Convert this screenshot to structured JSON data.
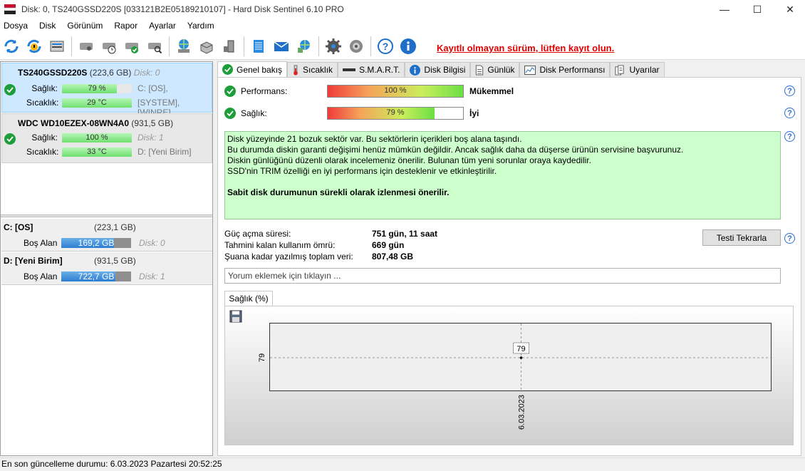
{
  "window": {
    "title": "Disk: 0, TS240GSSD220S [033121B2E05189210107]  -  Hard Disk Sentinel 6.10 PRO",
    "minimize": "—",
    "maximize": "☐",
    "close": "✕"
  },
  "menu": [
    "Dosya",
    "Disk",
    "Görünüm",
    "Rapor",
    "Ayarlar",
    "Yardım"
  ],
  "toolbar": {
    "registration_link": "Kayıtlı olmayan sürüm, lütfen kayıt olun."
  },
  "disks": [
    {
      "name": "TS240GSSD220S",
      "size": "(223,6 GB)",
      "disk_no": "Disk: 0",
      "health_label": "Sağlık:",
      "health_text": "79 %",
      "health_value": 79,
      "partition1": "C: [OS],",
      "temp_label": "Sıcaklık:",
      "temp_text": "29 °C",
      "temp_fill": 100,
      "partition2": "[SYSTEM],  [WINRE]"
    },
    {
      "name": "WDC WD10EZEX-08WN4A0",
      "size": "(931,5 GB)",
      "health_label": "Sağlık:",
      "health_text": "100 %",
      "health_value": 100,
      "partition1": "Disk: 1",
      "temp_label": "Sıcaklık:",
      "temp_text": "33 °C",
      "temp_fill": 100,
      "partition2": "D: [Yeni Birim]"
    }
  ],
  "volumes": [
    {
      "name": "C: [OS]",
      "size": "(223,1 GB)",
      "free_label": "Boş Alan",
      "free_text": "169,2 GB",
      "free_fraction": 0.758,
      "disk": "Disk: 0"
    },
    {
      "name": "D: [Yeni Birim]",
      "size": "(931,5 GB)",
      "free_label": "Boş Alan",
      "free_text": "722,7 GB",
      "free_fraction": 0.776,
      "disk": "Disk: 1"
    }
  ],
  "tabs": [
    "Genel bakış",
    "Sıcaklık",
    "S.M.A.R.T.",
    "Disk Bilgisi",
    "Günlük",
    "Disk Performansı",
    "Uyarılar"
  ],
  "overview": {
    "performance_label": "Performans:",
    "performance_text": "100 %",
    "performance_value": 100,
    "performance_rating": "Mükemmel",
    "health_label": "Sağlık:",
    "health_text": "79 %",
    "health_value": 79,
    "health_rating": "İyi",
    "message_lines": [
      "Disk yüzeyinde 21 bozuk sektör var. Bu sektörlerin içerikleri boş alana taşındı.",
      "Bu durumda diskin garanti değişimi henüz mümkün değildir. Ancak sağlık daha da düşerse ürünün servisine başvurunuz.",
      "Diskin günlüğünü düzenli olarak incelemeniz önerilir. Bulunan tüm yeni sorunlar oraya kaydedilir.",
      "SSD'nin TRIM özelliği en iyi performans için desteklenir ve etkinleştirilir."
    ],
    "message_bold": "Sabit disk durumunun sürekli olarak izlenmesi önerilir.",
    "power_on_label": "Güç açma süresi:",
    "power_on_value": "751 gün, 11 saat",
    "lifetime_label": "Tahmini kalan kullanım ömrü:",
    "lifetime_value": "669 gün",
    "written_label": "Şuana kadar yazılmış toplam veri:",
    "written_value": "807,48 GB",
    "test_button": "Testi Tekrarla",
    "comment_placeholder": "Yorum eklemek için tıklayın ...",
    "graph_tab": "Sağlık (%)"
  },
  "chart_data": {
    "type": "line",
    "x": [
      "6.03.2023"
    ],
    "series": [
      {
        "values": [
          79
        ]
      }
    ],
    "data_labels": [
      "79"
    ],
    "y_tick_labels": [
      "79"
    ],
    "x_tick_labels": [
      "6.03.2023"
    ],
    "grid": true
  },
  "status": "En son güncelleme durumu: 6.03.2023 Pazartesi 20:52:25"
}
